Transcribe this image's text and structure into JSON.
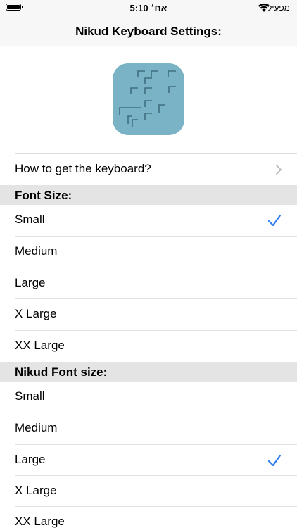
{
  "status_bar": {
    "time": "5:10 אח׳",
    "carrier": "מפעיל"
  },
  "nav": {
    "title": "Nikud Keyboard Settings:"
  },
  "help_row": {
    "label": "How to get the keyboard?"
  },
  "font_size": {
    "header": "Font Size:",
    "options": [
      "Small",
      "Medium",
      "Large",
      "X Large",
      "XX Large"
    ],
    "selected": "Small"
  },
  "nikud_font_size": {
    "header": "Nikud Font size:",
    "options": [
      "Small",
      "Medium",
      "Large",
      "X Large",
      "XX Large"
    ],
    "selected": "Large"
  },
  "colors": {
    "accent": "#2f7df6",
    "icon_bg": "#79b3c5",
    "section_bg": "#e4e4e4"
  }
}
